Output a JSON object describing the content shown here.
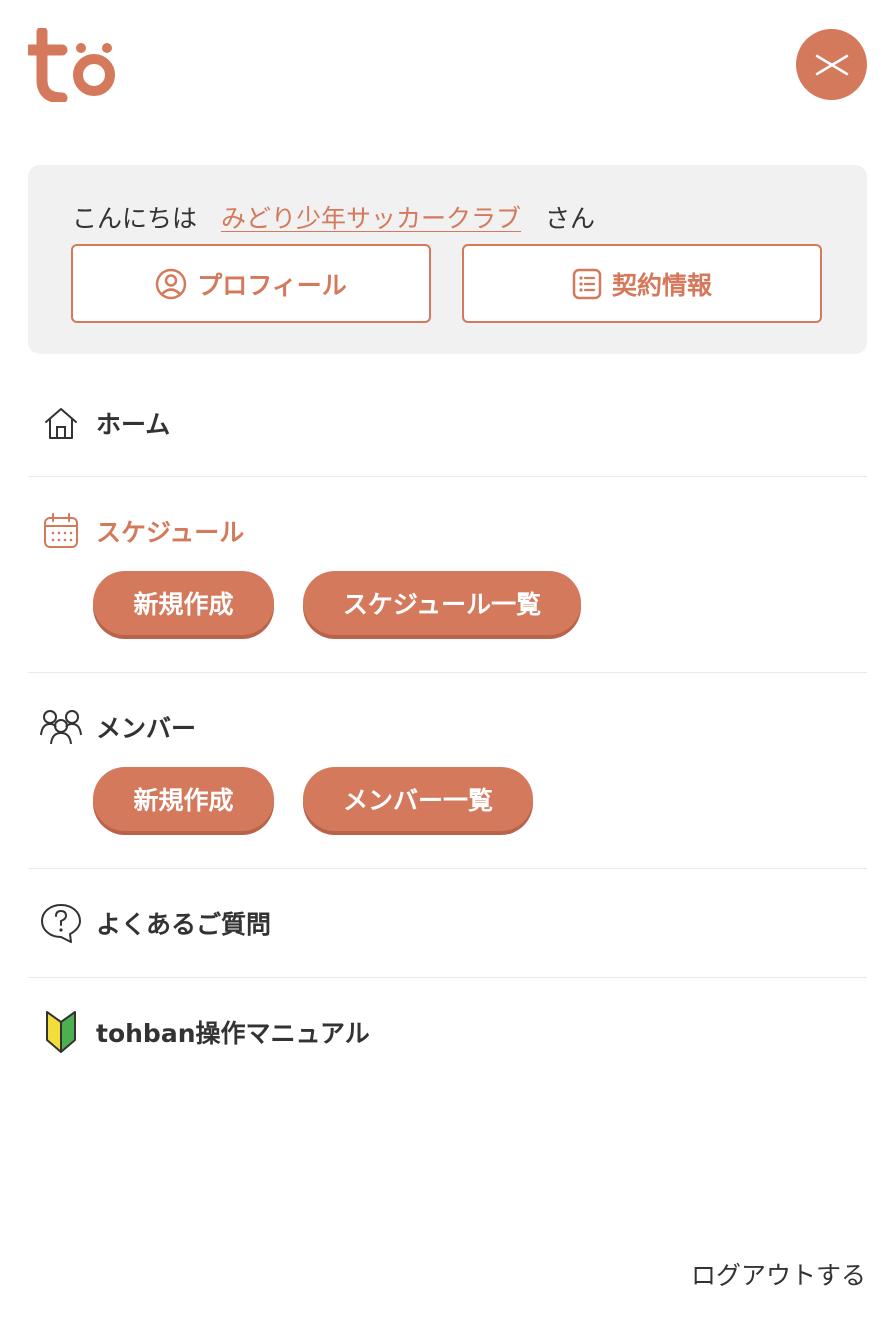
{
  "brand": {
    "logo_text": "tö",
    "accent_color": "#d4795c"
  },
  "header": {
    "close_icon": "close-icon"
  },
  "greeting": {
    "prefix": "こんにちは",
    "club_name": "みどり少年サッカークラブ",
    "suffix": "さん",
    "profile_label": "プロフィール",
    "contract_label": "契約情報"
  },
  "menu": {
    "home": {
      "label": "ホーム",
      "icon": "home-icon"
    },
    "schedule": {
      "label": "スケジュール",
      "icon": "calendar-icon",
      "new_label": "新規作成",
      "list_label": "スケジュール一覧"
    },
    "member": {
      "label": "メンバー",
      "icon": "people-icon",
      "new_label": "新規作成",
      "list_label": "メンバー一覧"
    },
    "faq": {
      "label": "よくあるご質問",
      "icon": "question-bubble-icon"
    },
    "manual": {
      "label": "tohban操作マニュアル",
      "icon": "beginner-mark-icon"
    }
  },
  "footer": {
    "logout_label": "ログアウトする"
  }
}
